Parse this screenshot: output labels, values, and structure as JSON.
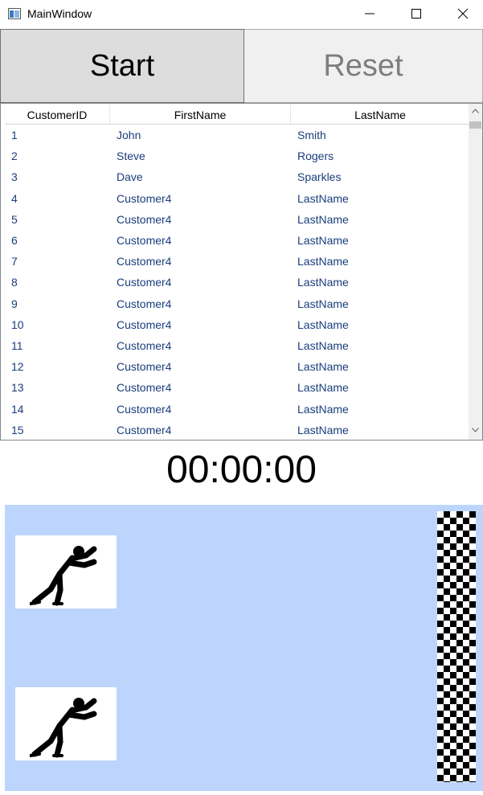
{
  "window": {
    "title": "MainWindow",
    "icons": {
      "app": "window-app-icon",
      "minimize": "minimize-icon",
      "maximize": "maximize-icon",
      "close": "close-icon"
    }
  },
  "controls": {
    "start_label": "Start",
    "reset_label": "Reset",
    "start_enabled": true,
    "reset_enabled": false
  },
  "grid": {
    "columns": [
      "CustomerID",
      "FirstName",
      "LastName"
    ],
    "rows": [
      [
        "1",
        "John",
        "Smith"
      ],
      [
        "2",
        "Steve",
        "Rogers"
      ],
      [
        "3",
        "Dave",
        "Sparkles"
      ],
      [
        "4",
        "Customer4",
        "LastName"
      ],
      [
        "5",
        "Customer4",
        "LastName"
      ],
      [
        "6",
        "Customer4",
        "LastName"
      ],
      [
        "7",
        "Customer4",
        "LastName"
      ],
      [
        "8",
        "Customer4",
        "LastName"
      ],
      [
        "9",
        "Customer4",
        "LastName"
      ],
      [
        "10",
        "Customer4",
        "LastName"
      ],
      [
        "11",
        "Customer4",
        "LastName"
      ],
      [
        "12",
        "Customer4",
        "LastName"
      ],
      [
        "13",
        "Customer4",
        "LastName"
      ],
      [
        "14",
        "Customer4",
        "LastName"
      ],
      [
        "15",
        "Customer4",
        "LastName"
      ]
    ]
  },
  "timer": {
    "value": "00:00:00"
  },
  "race": {
    "track_color": "#bdd5fd",
    "runners": [
      {
        "icon": "pushing-man-icon"
      },
      {
        "icon": "pushing-man-icon"
      }
    ],
    "finish_icon": "checkered-flag-icon"
  }
}
